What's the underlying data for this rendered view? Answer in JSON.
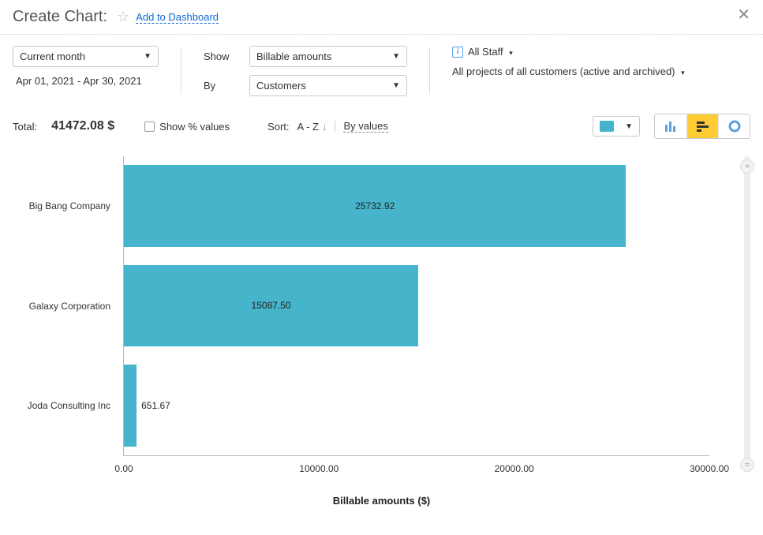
{
  "header": {
    "title": "Create Chart:",
    "add_link": "Add to Dashboard"
  },
  "period": {
    "selector": "Current month",
    "range": "Apr 01, 2021  -  Apr 30, 2021"
  },
  "show": {
    "label": "Show",
    "value": "Billable amounts"
  },
  "by": {
    "label": "By",
    "value": "Customers"
  },
  "scope": {
    "staff": "All Staff",
    "projects": "All projects of all customers (active and archived)"
  },
  "totals": {
    "label": "Total:",
    "value": "41472.08 $"
  },
  "show_pct": "Show % values",
  "sort": {
    "label": "Sort:",
    "az": "A - Z",
    "byvalues": "By values"
  },
  "chart_data": {
    "type": "bar",
    "orientation": "horizontal",
    "title": "",
    "xlabel": "Billable amounts ($)",
    "ylabel": "",
    "xlim": [
      0,
      30000
    ],
    "xticks": [
      0,
      10000,
      20000,
      30000
    ],
    "xtick_labels": [
      "0.00",
      "10000.00",
      "20000.00",
      "30000.00"
    ],
    "categories": [
      "Big Bang Company",
      "Galaxy Corporation",
      "Joda Consulting Inc"
    ],
    "values": [
      25732.92,
      15087.5,
      651.67
    ],
    "value_labels": [
      "25732.92",
      "15087.50",
      "651.67"
    ],
    "series_color": "#46b4ca"
  }
}
